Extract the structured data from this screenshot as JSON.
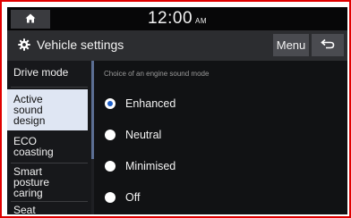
{
  "status": {
    "time": "12:00",
    "ampm": "AM"
  },
  "header": {
    "title": "Vehicle settings",
    "menu_label": "Menu"
  },
  "sidebar": {
    "items": [
      {
        "label": "Drive mode"
      },
      {
        "label": "Active sound design"
      },
      {
        "label": "ECO coasting"
      },
      {
        "label": "Smart posture caring"
      },
      {
        "label": "Seat"
      }
    ]
  },
  "main": {
    "caption": "Choice of an engine sound mode",
    "options": [
      {
        "label": "Enhanced",
        "selected": true
      },
      {
        "label": "Neutral",
        "selected": false
      },
      {
        "label": "Minimised",
        "selected": false
      },
      {
        "label": "Off",
        "selected": false
      }
    ]
  },
  "colors": {
    "accent": "#1d5fc9",
    "active_item_bg": "#dfe6f3",
    "frame_border": "#e00000"
  },
  "icons": {
    "home": "home-icon",
    "settings": "gear-icon",
    "back": "back-arrow-icon"
  }
}
